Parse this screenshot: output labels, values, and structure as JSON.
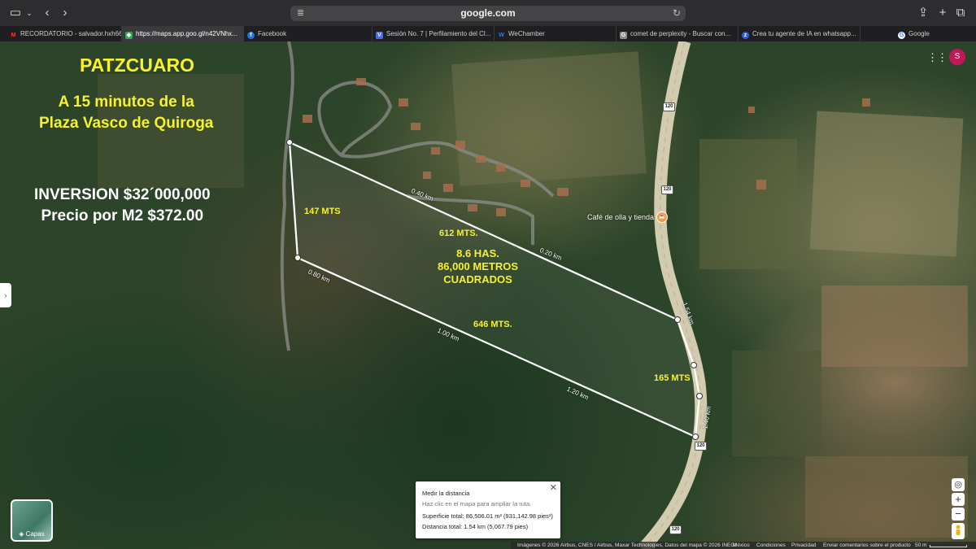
{
  "browser": {
    "address": "google.com",
    "tabs": [
      {
        "label": "RECORDATORIO - salvador.hxh66...",
        "favicon": "gmail-icon",
        "favicon_color": "#ea4335"
      },
      {
        "label": "https://maps.app.goo.gl/n42VNhx...",
        "favicon": "maps-icon",
        "favicon_color": "#34a853",
        "active": true
      },
      {
        "label": "Facebook",
        "favicon": "facebook-icon",
        "favicon_color": "#1877f2"
      },
      {
        "label": "Sesión No. 7 | Perfilamiento del Cl...",
        "favicon": "v-icon",
        "favicon_color": "#4a6ee0"
      },
      {
        "label": "WeChamber",
        "favicon": "wechamber-icon",
        "favicon_color": "#2d7be5"
      },
      {
        "label": "comet de perplexity - Buscar con...",
        "favicon": "g-icon",
        "favicon_color": "#8a8a8a"
      },
      {
        "label": "Crea tu agente de IA en whatsapp...",
        "favicon": "zapier-icon",
        "favicon_color": "#3060e0"
      },
      {
        "label": "Google",
        "favicon": "google-icon",
        "favicon_color": "#4285f4"
      }
    ]
  },
  "overlay": {
    "title": "PATZCUARO",
    "subtitle_line1": "A 15 minutos de la",
    "subtitle_line2": "Plaza Vasco de Quiroga",
    "investment": "INVERSION $32´000,000",
    "price": "Precio por M2 $372.00",
    "side_147": "147 MTS",
    "side_612": "612 MTS.",
    "side_646": "646 MTS.",
    "side_165": "165 MTS",
    "area_line1": "8.6 HAS.",
    "area_line2": "86,000 METROS",
    "area_line3": "CUADRADOS"
  },
  "map": {
    "distance_labels": [
      "0.40 km",
      "0.20 km",
      "0.80 km",
      "1.00 km",
      "1.20 km",
      "1.54 km",
      "1.40 km"
    ],
    "route_number": "120",
    "poi_label": "Café de olla y tienda",
    "account_initial": "S",
    "layers_label": "Capas"
  },
  "measure": {
    "title": "Medir la distancia",
    "hint": "Haz clic en el mapa para ampliar la ruta.",
    "area": "Superficie total: 86,506.01 m² (931,142.98 pies²)",
    "distance": "Distancia total: 1.54 km (5,067.79 pies)"
  },
  "footer": {
    "attribution": "Imágenes © 2026 Airbus, CNES / Airbus, Maxar Technologies, Datos del mapa © 2026 INEGI",
    "country": "México",
    "terms": "Condiciones",
    "privacy": "Privacidad",
    "feedback": "Enviar comentarios sobre el producto",
    "scale": "50 m"
  }
}
